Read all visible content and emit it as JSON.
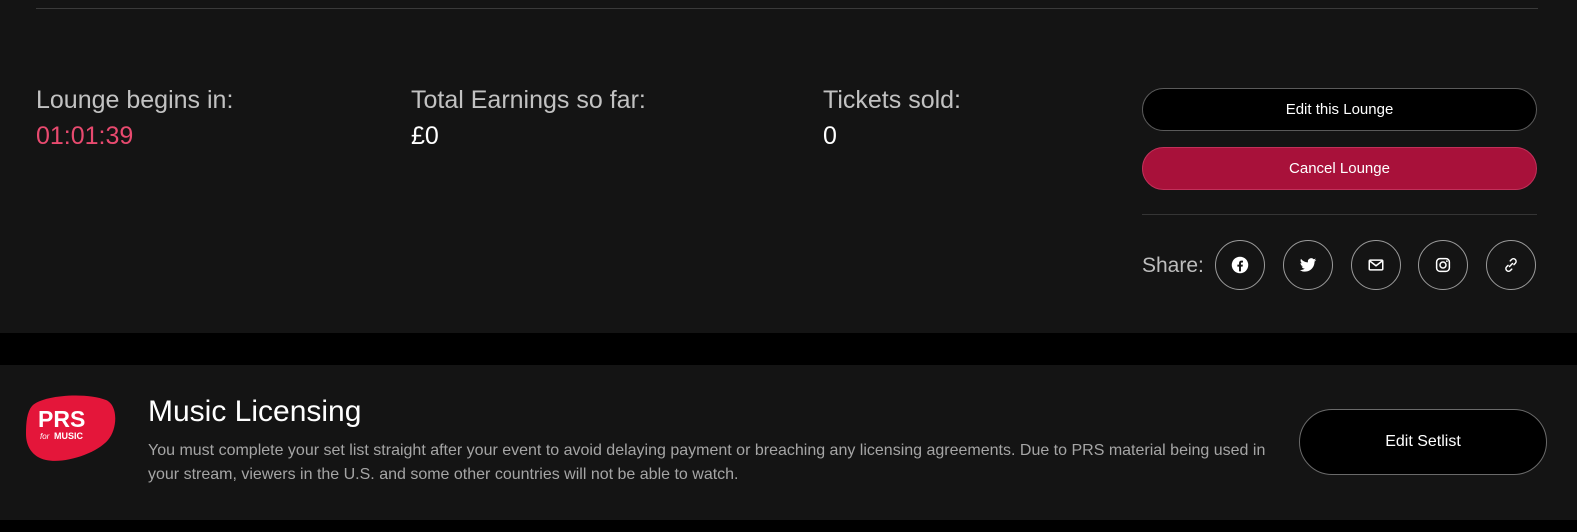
{
  "stats": {
    "begins_label": "Lounge begins in:",
    "begins_value": "01:01:39",
    "earnings_label": "Total Earnings so far:",
    "earnings_value": "£0",
    "tickets_label": "Tickets sold:",
    "tickets_value": "0"
  },
  "actions": {
    "edit_label": "Edit this Lounge",
    "cancel_label": "Cancel Lounge"
  },
  "share": {
    "label": "Share:",
    "icons": [
      "facebook-icon",
      "twitter-icon",
      "email-icon",
      "instagram-icon",
      "link-icon"
    ]
  },
  "licensing": {
    "logo_text": "PRS for MUSIC",
    "title": "Music Licensing",
    "description": "You must complete your set list straight after your event to avoid delaying payment or breaching any licensing agreements. Due to PRS material being used in your stream, viewers in the U.S. and some other countries will not be able to watch.",
    "edit_setlist_label": "Edit Setlist"
  },
  "colors": {
    "panel_bg": "#141414",
    "page_bg": "#000000",
    "accent": "#e84a6f",
    "cancel_bg": "#a8113a",
    "prs_red": "#e4163a"
  }
}
